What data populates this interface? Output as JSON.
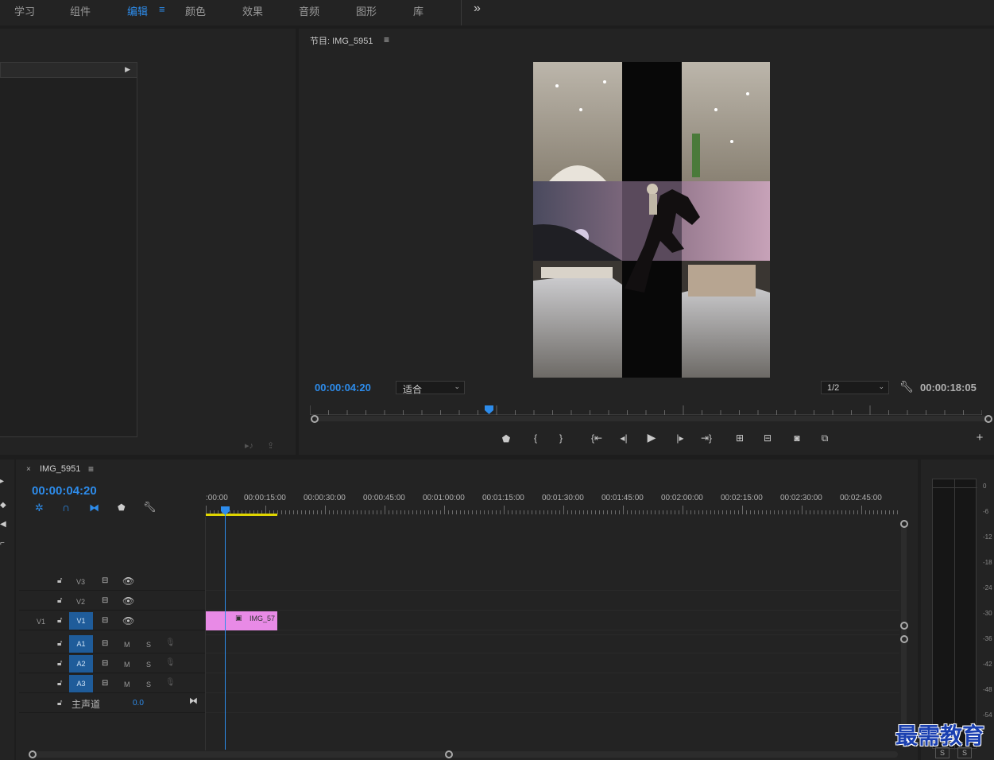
{
  "workspaces": {
    "items": [
      "学习",
      "组件",
      "编辑",
      "颜色",
      "效果",
      "音频",
      "图形",
      "库"
    ],
    "active": "编辑",
    "menu_glyph": "≡",
    "more_glyph": "»"
  },
  "program": {
    "title": "节目: IMG_5951",
    "menu_glyph": "≡",
    "timecode": "00:00:04:20",
    "zoom": "适合",
    "resolution": "1/2",
    "duration": "00:00:18:05"
  },
  "timeline": {
    "tab_close": "×",
    "sequence_name": "IMG_5951",
    "menu_glyph": "≡",
    "timecode": "00:00:04:20",
    "ruler": [
      ":00:00",
      "00:00:15:00",
      "00:00:30:00",
      "00:00:45:00",
      "00:01:00:00",
      "00:01:15:00",
      "00:01:30:00",
      "00:01:45:00",
      "00:02:00:00",
      "00:02:15:00",
      "00:02:30:00",
      "00:02:45:00"
    ],
    "video_tracks": [
      {
        "label": "V3"
      },
      {
        "label": "V2"
      },
      {
        "label": "V1",
        "source": "V1"
      }
    ],
    "audio_tracks": [
      {
        "label": "A1",
        "m": "M",
        "s": "S"
      },
      {
        "label": "A2",
        "m": "M",
        "s": "S"
      },
      {
        "label": "A3",
        "m": "M",
        "s": "S"
      }
    ],
    "master": {
      "label": "主声道",
      "value": "0.0"
    },
    "clip": {
      "name": "IMG_57",
      "color": "#e88ae6"
    }
  },
  "meter": {
    "scale": [
      "0",
      "-6",
      "-12",
      "-18",
      "-24",
      "-30",
      "-36",
      "-42",
      "-48",
      "-54"
    ],
    "solo": [
      "S",
      "S"
    ]
  },
  "watermark": "最需教育",
  "colors": {
    "accent": "#2d8ceb",
    "playhead": "#2d8ceb",
    "work_area": "#e0d600",
    "clip": "#e88ae6"
  }
}
